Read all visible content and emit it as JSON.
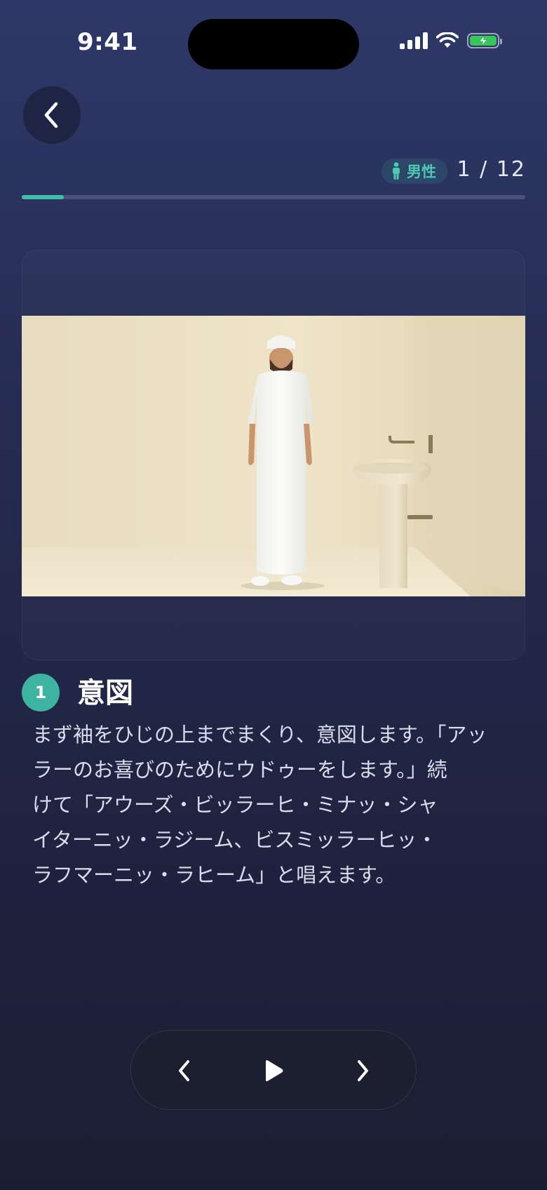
{
  "status_bar": {
    "time": "9:41"
  },
  "header": {
    "gender_label": "男性",
    "counter": "1 / 12",
    "progress": 0.083
  },
  "step": {
    "number": "1",
    "title": "意図",
    "description_lines": [
      "まず袖をひじの上までまくり、意図します。「アッ",
      "ラーのお喜びのためにウドゥーをします。」続",
      "けて「アウーズ・ビッラーヒ・ミナッ・シャ",
      "イターニッ・ラジーム、ビスミッラーヒッ・",
      "ラフマーニッ・ラヒーム」と唱えます。"
    ]
  },
  "icons": {
    "back": "chevron-left-icon",
    "gender": "person-icon",
    "prev": "chevron-left-icon",
    "play": "play-icon",
    "next": "chevron-right-icon",
    "signal": "cellular-signal-icon",
    "wifi": "wifi-icon",
    "battery": "battery-charging-icon"
  },
  "colors": {
    "accent": "#3cb4a0",
    "battery": "#35c759",
    "background_top": "#2e3868",
    "background_bottom": "#1b1e33"
  }
}
